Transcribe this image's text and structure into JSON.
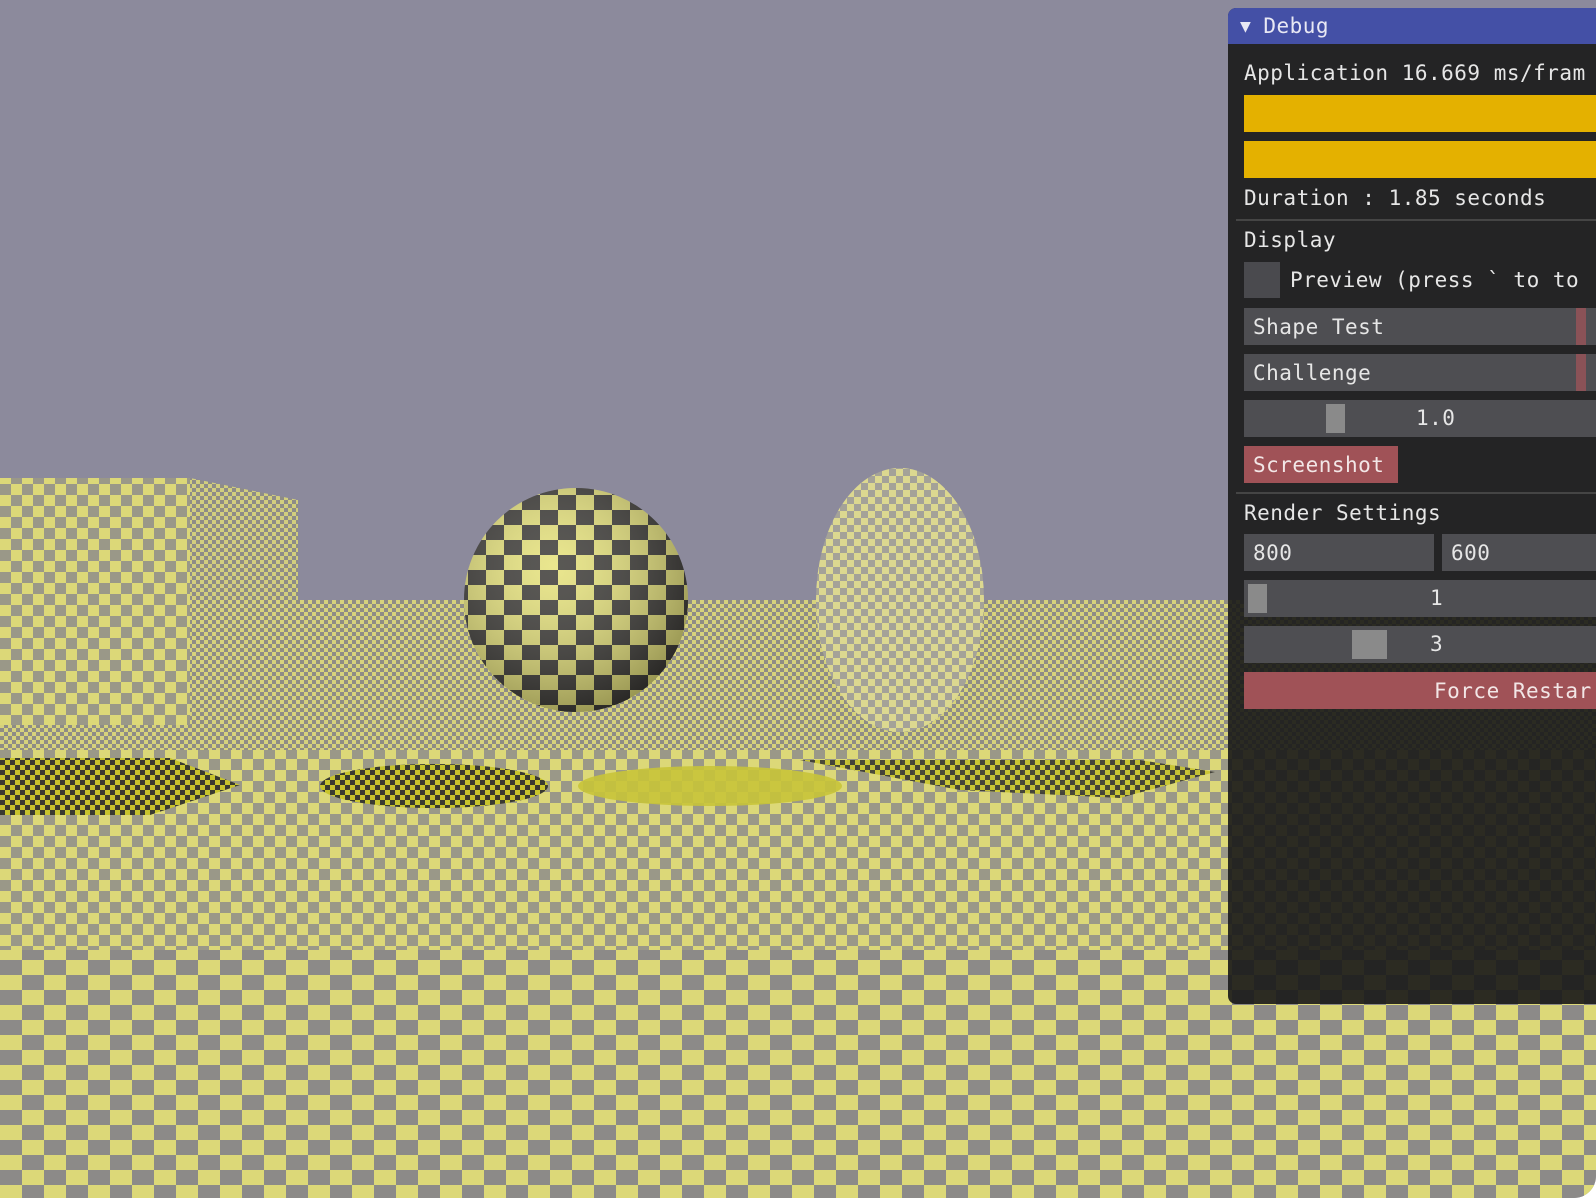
{
  "debug": {
    "title": "Debug",
    "collapse_icon": "triangle-down-icon",
    "application_line": "Application 16.669 ms/fram",
    "duration_line": "Duration : 1.85 seconds",
    "display_header": "Display",
    "preview_label": "Preview (press ` to to",
    "preview_checked": false,
    "shape_combo_value": "Shape Test",
    "challenge_combo_value": "Challenge",
    "scale_slider_value": "1.0",
    "screenshot_label": "Screenshot",
    "render_header": "Render Settings",
    "width_value": "800",
    "height_value": "600",
    "samples_slider_value": "1",
    "depth_slider_value": "3",
    "force_restart_label": "Force Restar"
  },
  "colors": {
    "sky": "#8c8a9c",
    "checker_yellow": "#dcd878",
    "checker_gray": "#8c8a88",
    "titlebar": "#4450a6",
    "plot_bar": "#e4b100",
    "button": "#a05257"
  }
}
